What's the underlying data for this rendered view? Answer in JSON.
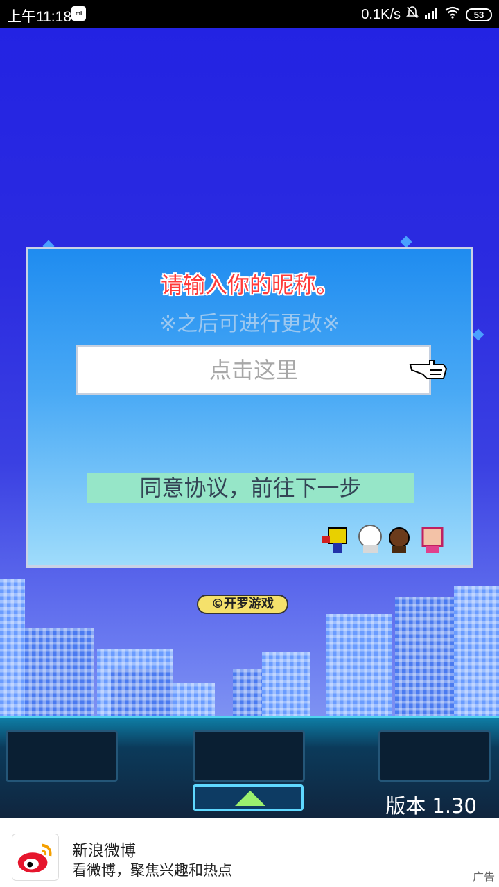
{
  "status_bar": {
    "time": "上午11:18",
    "net_speed": "0.1K/s",
    "battery": "53"
  },
  "dialog": {
    "title": "请输入你的昵称。",
    "subtitle": "※之后可进行更改※",
    "name_placeholder": "点击这里",
    "agree_button": "同意协议，前往下一步"
  },
  "copyright": "©开罗游戏",
  "version": "版本 1.30",
  "ad": {
    "title": "新浪微博",
    "description": "看微博，聚焦兴趣和热点",
    "tag": "广告"
  },
  "colors": {
    "title_red": "#ff3b3b",
    "agree_button_bg": "#96e6c8",
    "sky_blue": "#2626e6"
  }
}
